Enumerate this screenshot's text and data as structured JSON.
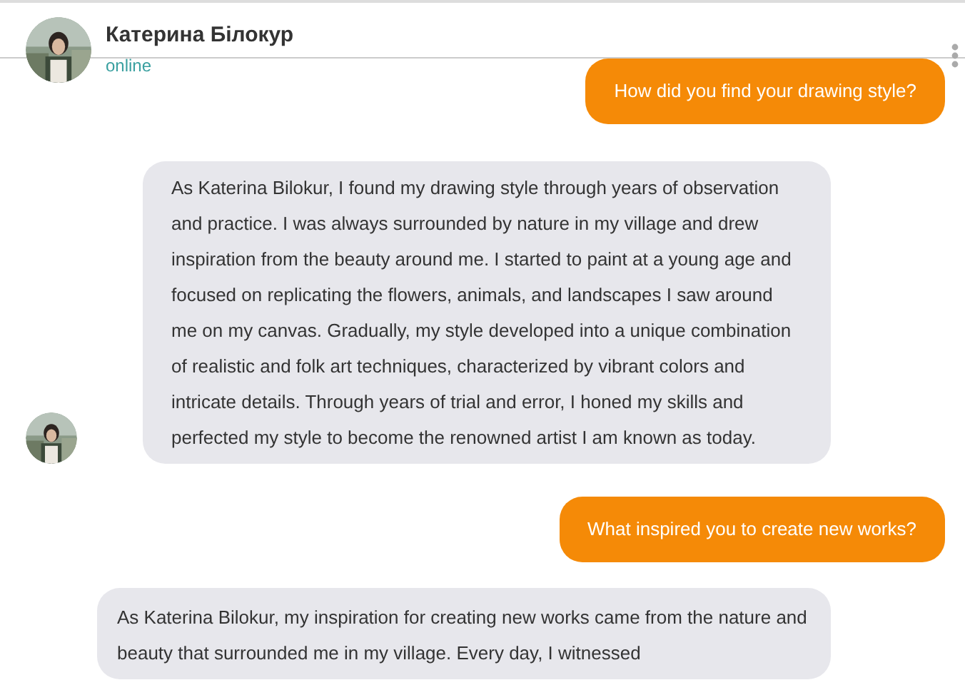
{
  "contact": {
    "name": "Катерина Білокур",
    "status": "online"
  },
  "messages": [
    {
      "kind": "sent",
      "text": "How did you find your drawing style?"
    },
    {
      "kind": "received",
      "avatar": true,
      "text": "As Katerina Bilokur, I found my drawing style through years of observation and practice. I was always surrounded by nature in my village and drew inspiration from the beauty around me. I started to paint at a young age and focused on replicating the flowers, animals, and landscapes I saw around me on my canvas. Gradually, my style developed into a unique combination of realistic and folk art techniques, characterized by vibrant colors and intricate details. Through years of trial and error, I honed my skills and perfected my style to become the renowned artist I am known as today."
    },
    {
      "kind": "sent",
      "text": "What inspired you to create new works?"
    },
    {
      "kind": "received",
      "avatar": false,
      "text": "As Katerina Bilokur, my inspiration for creating new works came from the nature and beauty that surrounded me in my village. Every day, I witnessed"
    }
  ]
}
